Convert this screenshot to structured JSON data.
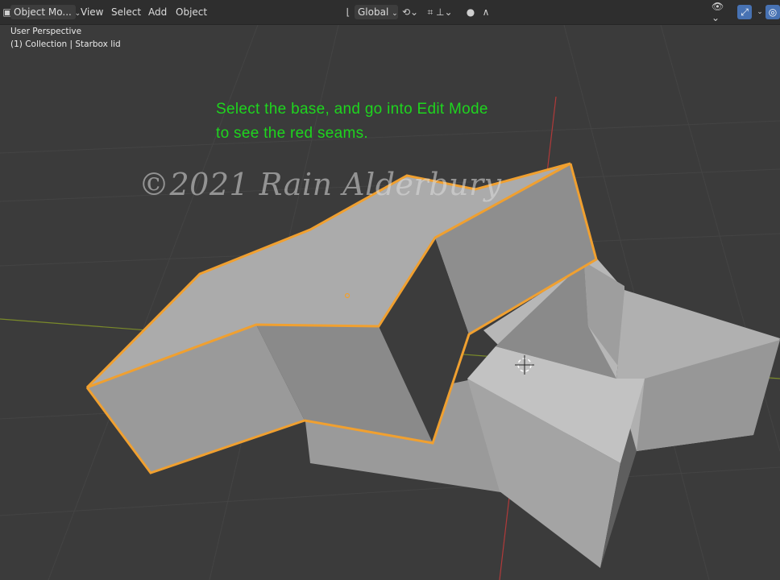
{
  "header": {
    "mode_select": "Object Mo...",
    "menus": [
      "View",
      "Select",
      "Add",
      "Object"
    ],
    "transform_orientation": "Global"
  },
  "viewport": {
    "perspective_label": "User Perspective",
    "collection_label": "(1) Collection | Starbox lid",
    "caption_line1": "Select the base, and go into Edit Mode",
    "caption_line2": "to see the red seams.",
    "watermark": "©2021 Rain Alderbury"
  },
  "colors": {
    "selection_outline": "#f0a030",
    "caption_text": "#1ed51e",
    "x_axis": "#b03a3a",
    "y_axis": "#7a8a2a"
  },
  "icons": {
    "editor_type": "editor-type-icon",
    "orientation": "orientation-icon",
    "pivot": "pivot-icon",
    "snap": "snap-icon",
    "proportional": "proportional-edit-icon",
    "visibility": "visibility-icon",
    "gizmo": "gizmo-icon",
    "overlay": "overlay-icon"
  }
}
